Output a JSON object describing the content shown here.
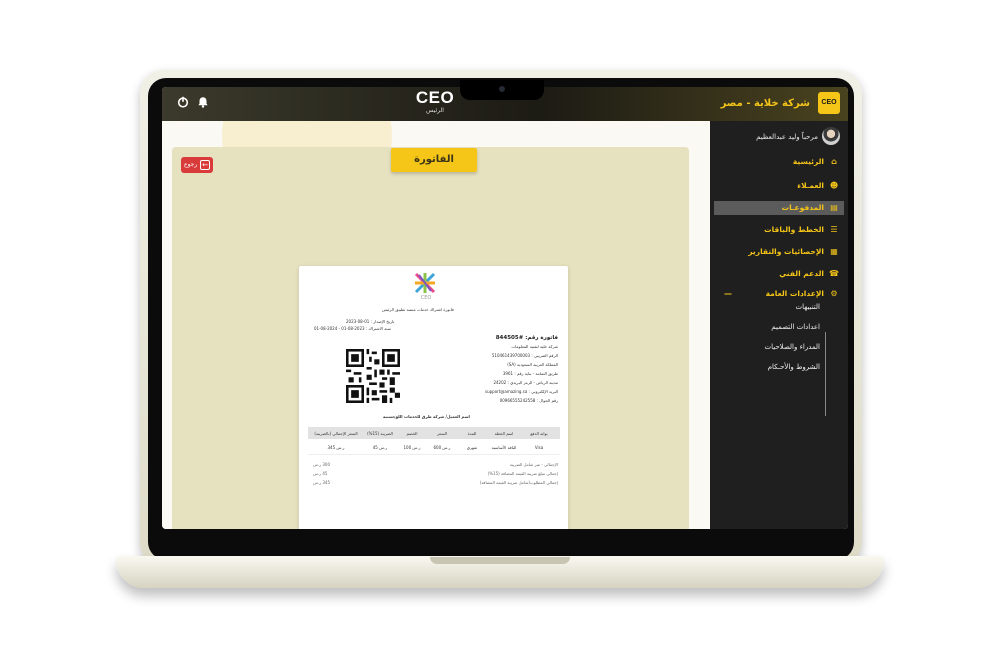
{
  "topbar": {
    "brand": "CEO",
    "brand_sub": "الرئيس",
    "company_name": "شركة خلاية - مصر",
    "company_logo_text": "CEO",
    "icons": [
      "power-icon",
      "bell-icon"
    ]
  },
  "content": {
    "page_title": "الفاتورة",
    "back_label": "رجوع"
  },
  "invoice": {
    "logo_text": "CEO",
    "subscription_title": "فاتورة اشتراك خدمات منصة تطبيق الرئيس",
    "issue_date": "تاريخ الإصدار : 01-08-2023",
    "subscription_year": "سنة الاشتراك : 2023-08-01 - 2024-08-01",
    "invoice_number": "فاتورة رقم: #844505",
    "company_lines": [
      "شركة خلية لتقنية المعلومات",
      "الرقم الضريبي : 510461439700003",
      "المملكة العربية السعودية (SA)",
      "طريق الثمامة - بناية رقم : 3961",
      "مدينة الرياض - الرمز البريدي : 24202",
      "البريد الإلكتروني : support@amazing.sa",
      "رقم الجوال : 00966555242558"
    ],
    "client_line": "اسم العميل/ شركة طرق للخدمات اللوجستية",
    "table_headers": [
      "بوابة الدفع",
      "اسم الخطة",
      "المدة",
      "السعر",
      "الخصم",
      "الضريبة (15%)",
      "السعر الإجمالي (بالضريبة)"
    ],
    "table_row": [
      "Visa",
      "الباقة الأساسية",
      "شهري",
      "600 ر.س",
      "100 ر.س",
      "45 ر.س",
      "345 ر.س"
    ],
    "summary_labels": [
      "الإجمالي - غير شامل الضريبة",
      "إجمالي مبلغ ضريبة القيمة المضافة (15%)",
      "إجمالي المطلوب(شامل ضريبة القيمة المضافة)"
    ],
    "summary_values": [
      "300 ر.س",
      "45 ر.س",
      "345 ر.س"
    ]
  },
  "sidebar": {
    "user_name": "مرحباً وليد عبدالعظيم",
    "nav": [
      {
        "label": "الرئيسية",
        "icon": "home-icon"
      },
      {
        "label": "العمـلاء",
        "icon": "users-icon"
      },
      {
        "label": "المدفوعـات",
        "icon": "payments-icon",
        "active": true
      },
      {
        "label": "الخطط والباقات",
        "icon": "list-icon"
      },
      {
        "label": "الإحصائيات والتقارير",
        "icon": "report-icon"
      },
      {
        "label": "الدعم الفني",
        "icon": "support-icon"
      },
      {
        "label": "الإعدادات العامة",
        "icon": "settings-icon",
        "expanded": true
      }
    ],
    "settings_sub": [
      "التنبيهات",
      "اعدادات التصميم",
      "المدراء والصلاحيات",
      "الشروط والأحـكام"
    ]
  },
  "colors": {
    "accent": "#f5c518",
    "sidebar_bg": "#1f1f1f",
    "back_button": "#d93b3b",
    "panel_bg": "#e6e2c0"
  }
}
